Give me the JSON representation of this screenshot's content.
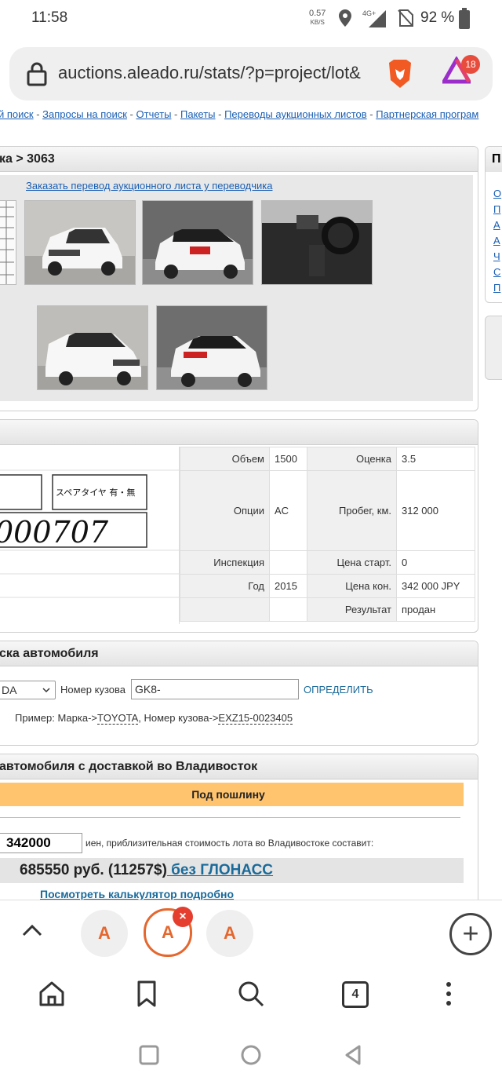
{
  "status": {
    "time": "11:58",
    "speed": "0.57",
    "speed_unit": "KB/S",
    "network": "4G+",
    "battery": "92 %"
  },
  "browser": {
    "url": "auctions.aleado.ru/stats/?p=project/lot&",
    "rewards_badge": "18",
    "tab_count": "4"
  },
  "nav": {
    "sep": " - ",
    "links": [
      "й поиск",
      "Запросы на поиск",
      "Отчеты",
      "Пакеты",
      "Переводы аукционных листов",
      "Партнерская програм"
    ]
  },
  "lot": {
    "title": "ка > 3063",
    "order_translation": "Заказать перевод аукционного листа у переводчика"
  },
  "details": {
    "rows": [
      {
        "l1": "Объем",
        "v1": "1500",
        "l2": "Оценка",
        "v2": "3.5"
      },
      {
        "l1": "Опции",
        "v1": "AC",
        "l2": "Пробег, км.",
        "v2": "312 000"
      },
      {
        "l1": "Инспекция",
        "v1": "",
        "l2": "Цена старт.",
        "v2": "0"
      },
      {
        "l1": "Год",
        "v1": "2015",
        "l2": "Цена кон.",
        "v2": "342 000 JPY"
      },
      {
        "l1": "",
        "v1": "",
        "l2": "Результат",
        "v2": "продан"
      }
    ],
    "sheet_text": "000707",
    "sheet_label": "スペアタイヤ 有・無"
  },
  "search": {
    "title": "ска автомобиля",
    "make": "DA",
    "body_label": "Номер кузова",
    "body_value": "GK8-",
    "detect": "ОПРЕДЕЛИТЬ",
    "example_prefix": "Пример: Марка->",
    "example_make": "TOYOTA",
    "example_mid": ", Номер кузова->",
    "example_body": "EXZ15-0023405"
  },
  "calc": {
    "title": "автомобиля с доставкой во Владивосток",
    "duty": "Под пошлину",
    "price": "342000",
    "note": "иен, приблизительная стоимость лота во Владивостоке составит:",
    "total": "685550 руб. (11257$)",
    "glonass": " без ГЛОНАСС",
    "details_link": "Посмотреть калькулятор подробно"
  },
  "side": {
    "title": "П",
    "links": [
      "О",
      "П",
      "А",
      "А",
      "Ч",
      "С",
      "П"
    ]
  },
  "tabs": {
    "letter": "A",
    "close": "×"
  }
}
